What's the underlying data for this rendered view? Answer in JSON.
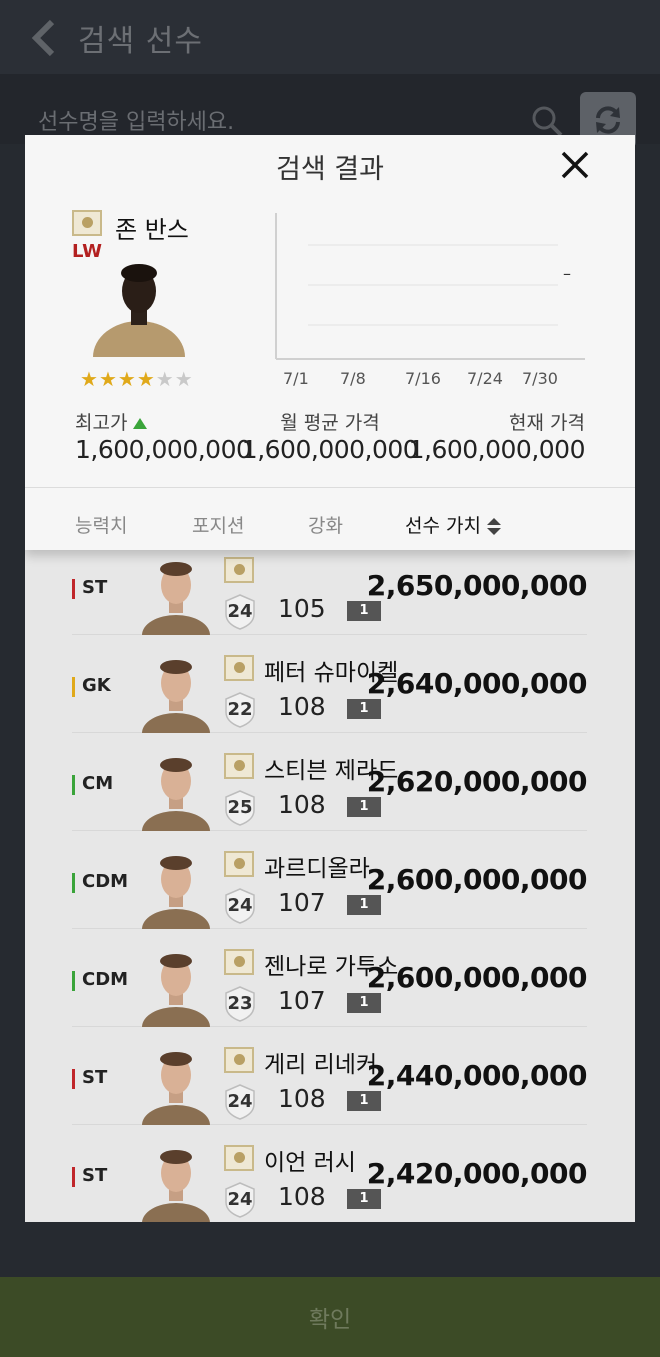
{
  "app": {
    "title": "검색 선수"
  },
  "search": {
    "placeholder": "선수명을 입력하세요."
  },
  "modal": {
    "title": "검색 결과",
    "player": {
      "name": "존 반스",
      "position": "LW",
      "stars_filled": 4,
      "stars_total": 6
    },
    "chart_data": {
      "type": "line",
      "x": [
        "7/1",
        "7/8",
        "7/16",
        "7/24",
        "7/30"
      ],
      "series": [],
      "annotation": "–",
      "grid": true
    },
    "prices": [
      {
        "label": "최고가",
        "value": "1,600,000,000",
        "trend_icon": "up-arrow-icon"
      },
      {
        "label": "월 평균 가격",
        "value": "1,600,000,000"
      },
      {
        "label": "현재 가격",
        "value": "1,600,000,000"
      }
    ],
    "tabs": [
      {
        "label": "능력치",
        "active": false
      },
      {
        "label": "포지션",
        "active": false
      },
      {
        "label": "강화",
        "active": false
      },
      {
        "label": "선수 가치",
        "active": true,
        "icon": "sort-icon"
      }
    ],
    "players": [
      {
        "position": "ST",
        "pos_color": "#c0262a",
        "name": "",
        "season": "24",
        "ovr": "105",
        "grade": "1",
        "price": "2,650,000,000"
      },
      {
        "position": "GK",
        "pos_color": "#e0a91a",
        "name": "페터 슈마이켈",
        "season": "22",
        "ovr": "108",
        "grade": "1",
        "price": "2,640,000,000"
      },
      {
        "position": "CM",
        "pos_color": "#3aa43a",
        "name": "스티븐 제라드",
        "season": "25",
        "ovr": "108",
        "grade": "1",
        "price": "2,620,000,000"
      },
      {
        "position": "CDM",
        "pos_color": "#3aa43a",
        "name": "과르디올라",
        "season": "24",
        "ovr": "107",
        "grade": "1",
        "price": "2,600,000,000"
      },
      {
        "position": "CDM",
        "pos_color": "#3aa43a",
        "name": "젠나로 가투소",
        "season": "23",
        "ovr": "107",
        "grade": "1",
        "price": "2,600,000,000"
      },
      {
        "position": "ST",
        "pos_color": "#c0262a",
        "name": "게리 리네커",
        "season": "24",
        "ovr": "108",
        "grade": "1",
        "price": "2,440,000,000"
      },
      {
        "position": "ST",
        "pos_color": "#c0262a",
        "name": "이언 러시",
        "season": "24",
        "ovr": "108",
        "grade": "1",
        "price": "2,420,000,000"
      }
    ]
  },
  "confirm": {
    "label": "확인"
  }
}
